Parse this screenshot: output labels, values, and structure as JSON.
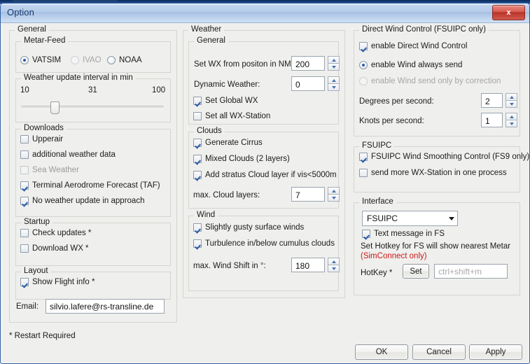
{
  "window": {
    "title": "Option",
    "close_label": "x"
  },
  "left": {
    "general_label": "General",
    "metar_feed": {
      "label": "Metar-Feed",
      "options": [
        {
          "label": "VATSIM",
          "selected": true,
          "disabled": false
        },
        {
          "label": "IVAO",
          "selected": false,
          "disabled": true
        },
        {
          "label": "NOAA",
          "selected": false,
          "disabled": false
        }
      ]
    },
    "interval": {
      "label": "Weather update interval in min",
      "min_label": "10",
      "mid_label": "31",
      "max_label": "100",
      "value": 31,
      "min": 10,
      "max": 100
    },
    "downloads": {
      "label": "Downloads",
      "items": [
        {
          "label": "Upperair",
          "checked": false,
          "disabled": false
        },
        {
          "label": "additional weather data",
          "checked": false,
          "disabled": false
        },
        {
          "label": "Sea Weather",
          "checked": false,
          "disabled": true
        },
        {
          "label": "Terminal Aerodrome Forecast (TAF)",
          "checked": true,
          "disabled": false
        },
        {
          "label": "No weather update in approach",
          "checked": true,
          "disabled": false
        }
      ]
    },
    "startup": {
      "label": "Startup",
      "items": [
        {
          "label": "Check updates *",
          "checked": false,
          "disabled": false
        },
        {
          "label": "Download WX *",
          "checked": false,
          "disabled": false
        }
      ]
    },
    "layout": {
      "label": "Layout",
      "items": [
        {
          "label": "Show Flight info *",
          "checked": true,
          "disabled": false
        }
      ]
    },
    "email": {
      "label": "Email:",
      "value": "silvio.lafere@rs-transline.de"
    }
  },
  "middle": {
    "weather_label": "Weather",
    "general": {
      "label": "General",
      "set_wx_label": "Set WX from positon in NM:",
      "set_wx_value": "200",
      "dynamic_label": "Dynamic Weather:",
      "dynamic_value": "0",
      "items": [
        {
          "label": "Set Global WX",
          "checked": true
        },
        {
          "label": "Set all WX-Station",
          "checked": false
        }
      ]
    },
    "clouds": {
      "label": "Clouds",
      "items": [
        {
          "label": "Generate Cirrus",
          "checked": true
        },
        {
          "label": "Mixed Clouds (2 layers)",
          "checked": true
        },
        {
          "label": "Add stratus Cloud layer if vis<5000m",
          "checked": true
        }
      ],
      "max_layers_label": "max. Cloud layers:",
      "max_layers_value": "7"
    },
    "wind": {
      "label": "Wind",
      "items": [
        {
          "label": "Slightly gusty surface winds",
          "checked": true
        },
        {
          "label": "Turbulence in/below cumulus clouds",
          "checked": true
        }
      ],
      "max_shift_label": "max. Wind Shift in °:",
      "max_shift_value": "180"
    }
  },
  "right": {
    "direct_wind": {
      "label": "Direct Wind Control (FSUIPC only)",
      "enable_checkbox": {
        "label": "enable Direct Wind Control",
        "checked": true
      },
      "radios": [
        {
          "label": "enable Wind always send",
          "selected": true,
          "disabled": false
        },
        {
          "label": "enable Wind send only by correction",
          "selected": false,
          "disabled": true
        }
      ],
      "degrees_label": "Degrees per second:",
      "degrees_value": "2",
      "knots_label": "Knots per second:",
      "knots_value": "1"
    },
    "fsuipc": {
      "label": "FSUIPC",
      "items": [
        {
          "label": "FSUIPC Wind Smoothing Control (FS9 only)",
          "checked": true
        },
        {
          "label": "send more WX-Station in one process",
          "checked": false
        }
      ]
    },
    "interface": {
      "label": "Interface",
      "combo_value": "FSUIPC",
      "text_message": {
        "label": "Text message in FS",
        "checked": true
      },
      "hotkey_info_line1": "Set Hotkey for FS will show nearest Metar",
      "hotkey_info_line2": "(SimConnect only)",
      "hotkey_label": "HotKey *",
      "set_button": "Set",
      "hotkey_placeholder": "ctrl+shift+m"
    }
  },
  "footer": {
    "restart_note": "* Restart Required",
    "ok": "OK",
    "cancel": "Cancel",
    "apply": "Apply"
  }
}
